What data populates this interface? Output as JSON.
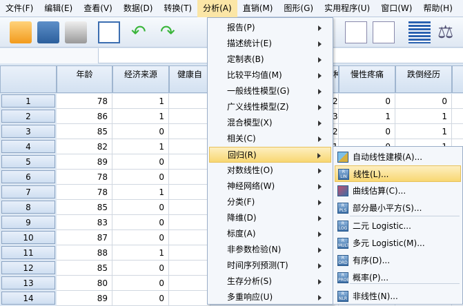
{
  "menubar": [
    "文件(F)",
    "编辑(E)",
    "查看(V)",
    "数据(D)",
    "转换(T)",
    "分析(A)",
    "直销(M)",
    "图形(G)",
    "实用程序(U)",
    "窗口(W)",
    "帮助(H)"
  ],
  "toolbar_icons": [
    "open-folder-icon",
    "save-icon",
    "print-icon",
    "recall-dialog-icon",
    "undo-icon",
    "redo-icon",
    "goto-case-icon",
    "select-cases-icon",
    "weight-cases-icon",
    "value-labels-icon",
    "scale-icon"
  ],
  "columns": [
    "年龄",
    "经济来源",
    "健康自",
    "种",
    "慢性疼痛",
    "跌倒经历"
  ],
  "rows": [
    {
      "n": "1",
      "age": "78",
      "econ": "1",
      "c4": "2",
      "pain": "0",
      "fall": "0"
    },
    {
      "n": "2",
      "age": "86",
      "econ": "1",
      "c4": "3",
      "pain": "1",
      "fall": "1"
    },
    {
      "n": "3",
      "age": "85",
      "econ": "0",
      "c4": "2",
      "pain": "0",
      "fall": "1"
    },
    {
      "n": "4",
      "age": "82",
      "econ": "1",
      "c4": "1",
      "pain": "0",
      "fall": "1"
    },
    {
      "n": "5",
      "age": "89",
      "econ": "0"
    },
    {
      "n": "6",
      "age": "78",
      "econ": "0"
    },
    {
      "n": "7",
      "age": "78",
      "econ": "1"
    },
    {
      "n": "8",
      "age": "85",
      "econ": "0"
    },
    {
      "n": "9",
      "age": "83",
      "econ": "0"
    },
    {
      "n": "10",
      "age": "87",
      "econ": "0"
    },
    {
      "n": "11",
      "age": "88",
      "econ": "1"
    },
    {
      "n": "12",
      "age": "85",
      "econ": "0"
    },
    {
      "n": "13",
      "age": "80",
      "econ": "0"
    },
    {
      "n": "14",
      "age": "89",
      "econ": "0"
    }
  ],
  "analyze_menu": [
    "报告(P)",
    "描述统计(E)",
    "定制表(B)",
    "比较平均值(M)",
    "一般线性模型(G)",
    "广义线性模型(Z)",
    "混合模型(X)",
    "相关(C)",
    "回归(R)",
    "对数线性(O)",
    "神经网络(W)",
    "分类(F)",
    "降维(D)",
    "标度(A)",
    "非参数检验(N)",
    "时间序列预测(T)",
    "生存分析(S)",
    "多重响应(U)"
  ],
  "regression_menu": [
    {
      "label": "自动线性建模(A)...",
      "icon": "auto-linear-icon"
    },
    {
      "label": "线性(L)...",
      "icon": "LIN"
    },
    {
      "label": "曲线估算(C)...",
      "icon": "curve-icon"
    },
    {
      "label": "部分最小平方(S)...",
      "icon": "PLS"
    },
    {
      "label": "二元 Logistic...",
      "icon": "LOG"
    },
    {
      "label": "多元 Logistic(M)...",
      "icon": "MULT"
    },
    {
      "label": "有序(D)...",
      "icon": "ORD"
    },
    {
      "label": "概率(P)...",
      "icon": "PROB"
    },
    {
      "label": "非线性(N)...",
      "icon": "NLR"
    }
  ]
}
